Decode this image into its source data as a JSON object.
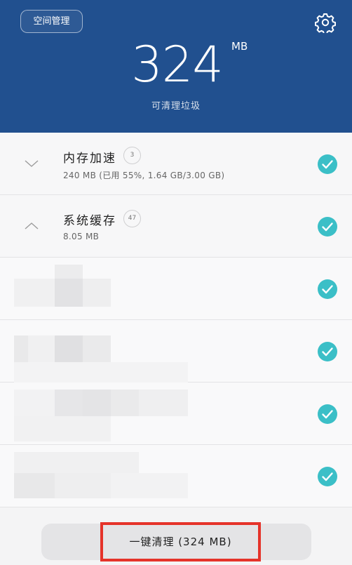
{
  "header": {
    "space_button_label": "空间管理",
    "settings_icon": "gear-icon",
    "junk_size": "324",
    "junk_unit": "MB",
    "junk_label": "可清理垃圾",
    "background_color": "#21508f"
  },
  "items": [
    {
      "title": "内存加速",
      "count": "3",
      "detail": "240 MB (已用 55%, 1.64 GB/3.00 GB)",
      "expanded": false,
      "checked": true
    },
    {
      "title": "系统缓存",
      "count": "47",
      "detail": "8.05 MB",
      "expanded": true,
      "checked": true
    }
  ],
  "blurred_items_checked": [
    true,
    true,
    true,
    true
  ],
  "clean_button": {
    "label": "一键清理 (324 MB)"
  },
  "colors": {
    "check_teal": "#3bbfc7",
    "highlight_red": "#e5332a"
  }
}
